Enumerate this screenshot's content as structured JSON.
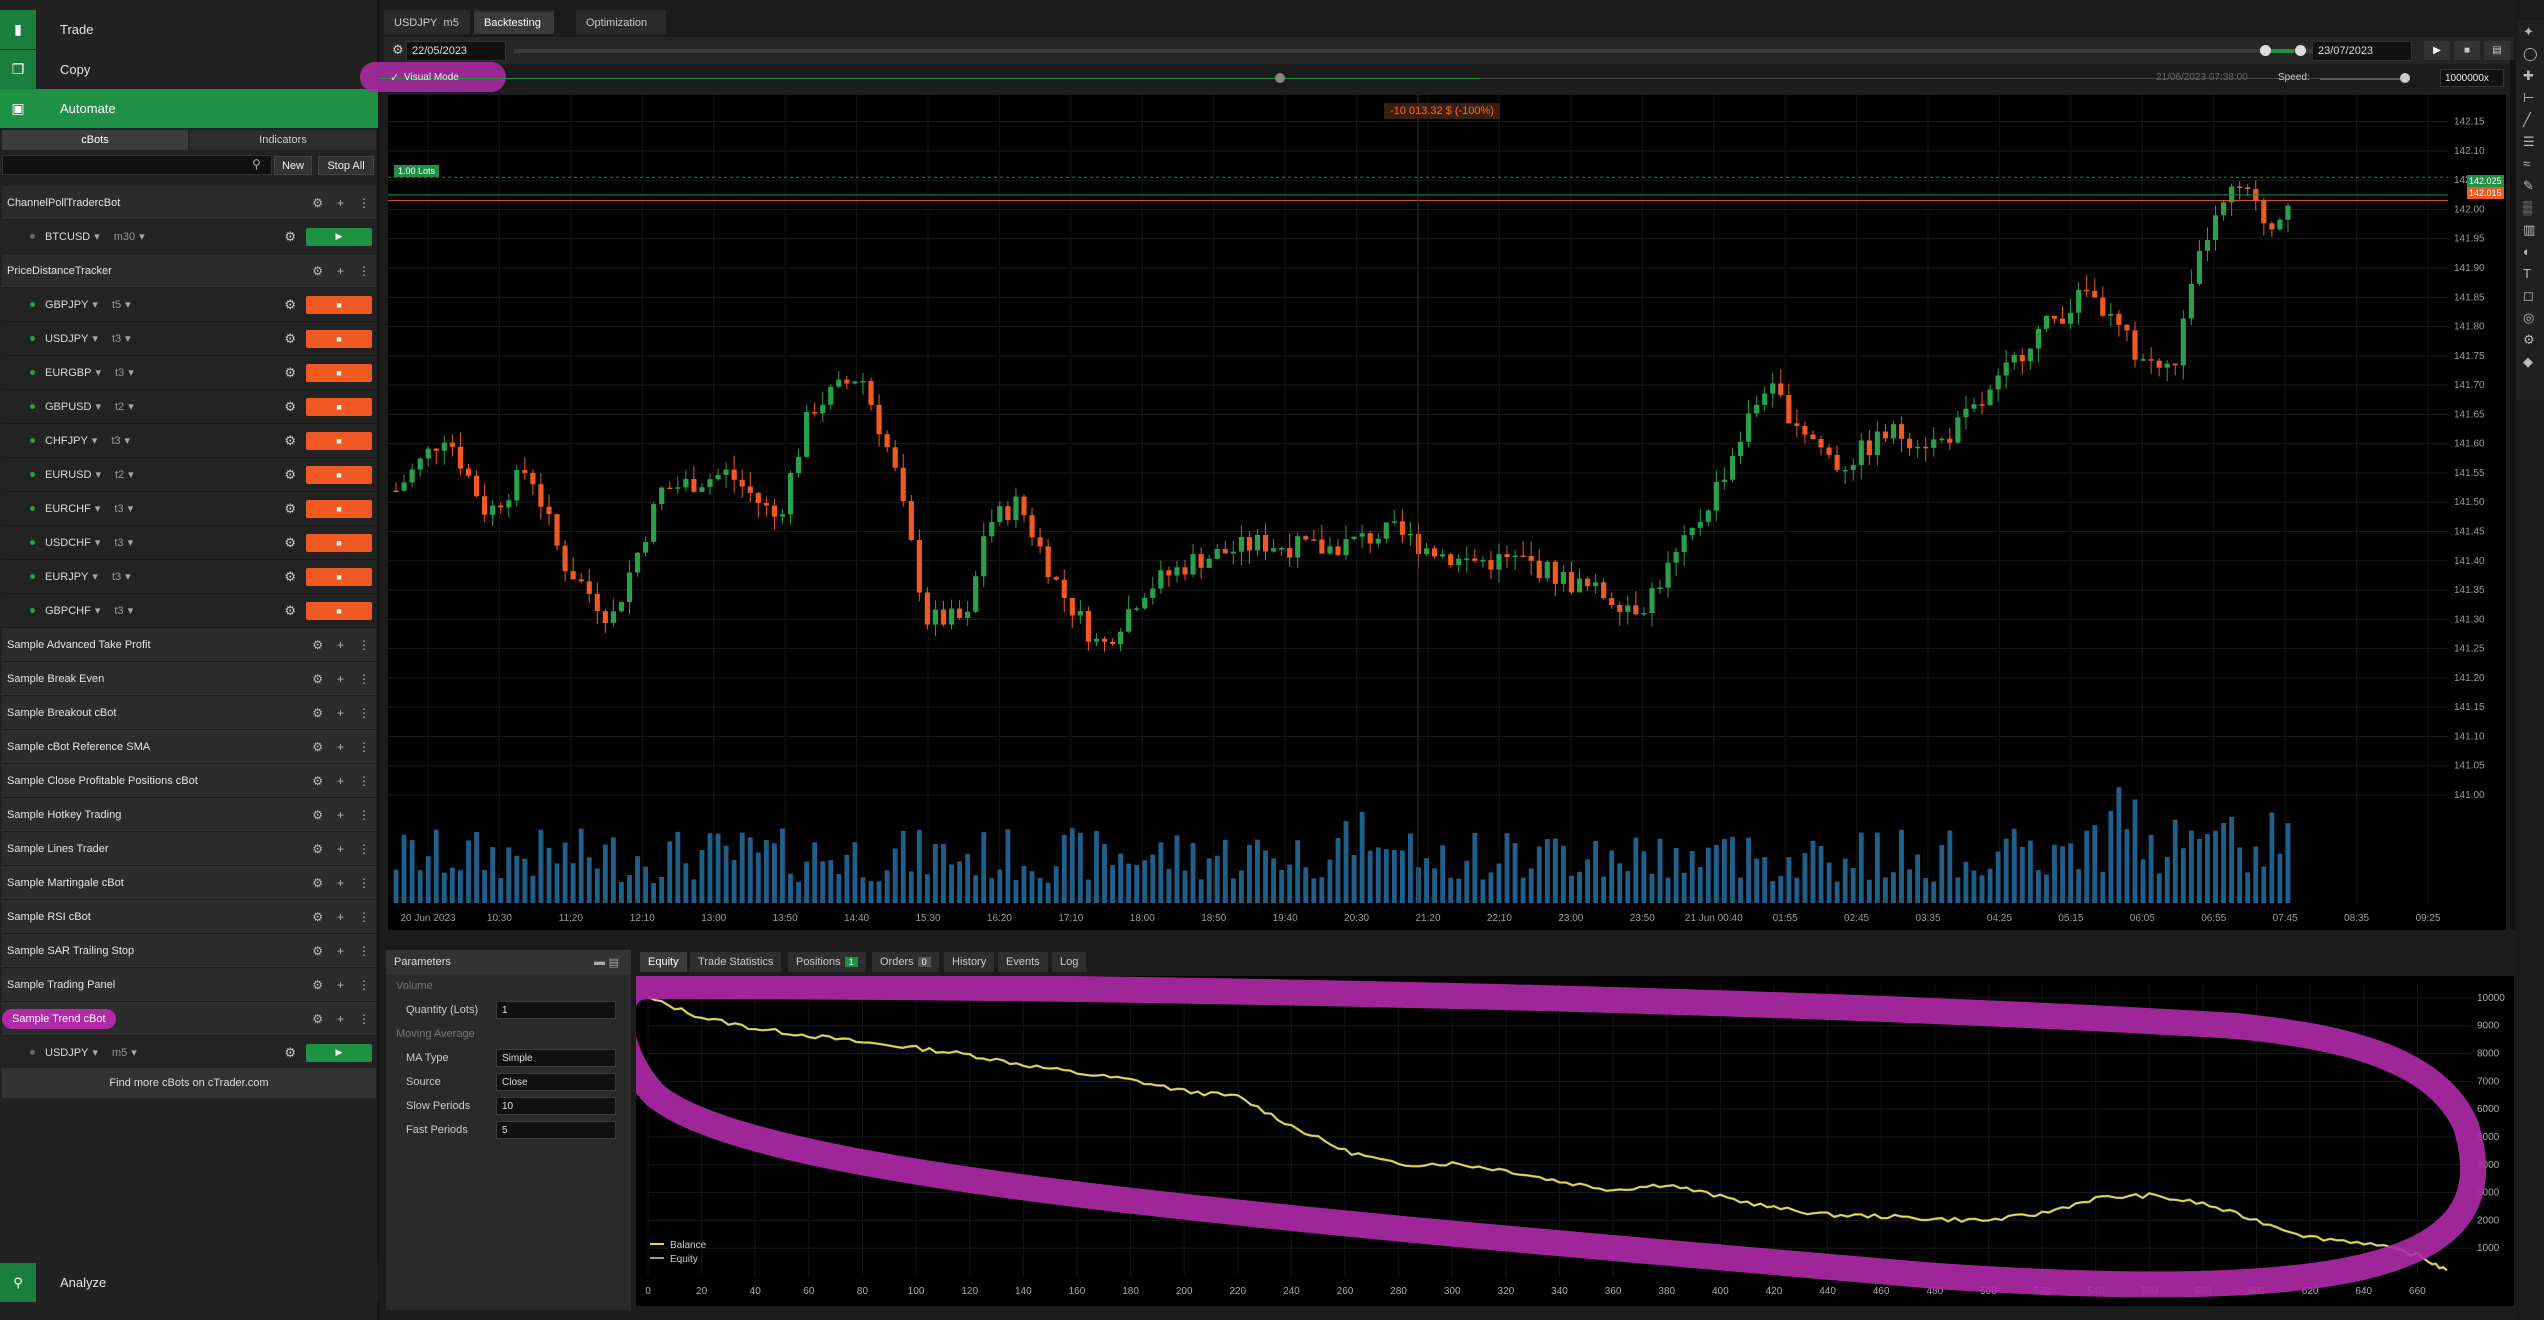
{
  "nav": {
    "trade": "Trade",
    "copy": "Copy",
    "automate": "Automate",
    "analyze": "Analyze"
  },
  "subtabs": [
    "cBots",
    "Indicators"
  ],
  "buttons": {
    "new": "New",
    "stop_all": "Stop All",
    "find_more": "Find more cBots on cTrader.com"
  },
  "bots": [
    {
      "type": "group",
      "name": "ChannelPollTradercBot"
    },
    {
      "type": "inst",
      "symbol": "BTCUSD",
      "tf": "m30",
      "running": false
    },
    {
      "type": "group",
      "name": "PriceDistanceTracker"
    },
    {
      "type": "inst",
      "symbol": "GBPJPY",
      "tf": "t5",
      "running": true
    },
    {
      "type": "inst",
      "symbol": "USDJPY",
      "tf": "t3",
      "running": true
    },
    {
      "type": "inst",
      "symbol": "EURGBP",
      "tf": "t3",
      "running": true
    },
    {
      "type": "inst",
      "symbol": "GBPUSD",
      "tf": "t2",
      "running": true
    },
    {
      "type": "inst",
      "symbol": "CHFJPY",
      "tf": "t3",
      "running": true
    },
    {
      "type": "inst",
      "symbol": "EURUSD",
      "tf": "t2",
      "running": true
    },
    {
      "type": "inst",
      "symbol": "EURCHF",
      "tf": "t3",
      "running": true
    },
    {
      "type": "inst",
      "symbol": "USDCHF",
      "tf": "t3",
      "running": true
    },
    {
      "type": "inst",
      "symbol": "EURJPY",
      "tf": "t3",
      "running": true
    },
    {
      "type": "inst",
      "symbol": "GBPCHF",
      "tf": "t3",
      "running": true
    },
    {
      "type": "group",
      "name": "Sample Advanced Take Profit"
    },
    {
      "type": "group",
      "name": "Sample Break Even"
    },
    {
      "type": "group",
      "name": "Sample Breakout cBot"
    },
    {
      "type": "group",
      "name": "Sample cBot Reference SMA"
    },
    {
      "type": "group",
      "name": "Sample Close Profitable Positions cBot"
    },
    {
      "type": "group",
      "name": "Sample Hotkey Trading"
    },
    {
      "type": "group",
      "name": "Sample Lines Trader"
    },
    {
      "type": "group",
      "name": "Sample Martingale cBot"
    },
    {
      "type": "group",
      "name": "Sample RSI cBot"
    },
    {
      "type": "group",
      "name": "Sample SAR Trailing Stop"
    },
    {
      "type": "group",
      "name": "Sample Trading Panel"
    },
    {
      "type": "group",
      "name": "Sample Trend cBot",
      "highlight": true
    },
    {
      "type": "inst",
      "symbol": "USDJPY",
      "tf": "m5",
      "running": false
    }
  ],
  "tabs": {
    "symbol": "USDJPY",
    "tf": "m5",
    "backtesting": "Backtesting",
    "optimization": "Optimization"
  },
  "ctrl": {
    "start_date": "22/05/2023",
    "end_date": "23/07/2023",
    "visual_mode": "Visual Mode",
    "current_time": "21/06/2023 07:38:00",
    "speed_label": "Speed:",
    "speed_value": "1000000x"
  },
  "chart": {
    "pnl_label": "-10 013.32 $ (-100%)",
    "lots_label": "1.00 Lots",
    "price_tag": "142.025",
    "price_tag2": "142.015",
    "y_ticks": [
      "142.15",
      "142.10",
      "142.05",
      "142.00",
      "141.95",
      "141.90",
      "141.85",
      "141.80",
      "141.75",
      "141.70",
      "141.65",
      "141.60",
      "141.55",
      "141.50",
      "141.45",
      "141.40",
      "141.35",
      "141.30",
      "141.25",
      "141.20",
      "141.15",
      "141.10",
      "141.05",
      "141.00"
    ],
    "x_ticks": [
      "20 Jun 2023",
      "10:30",
      "11:20",
      "12:10",
      "13:00",
      "13:50",
      "14:40",
      "15:30",
      "16:20",
      "17:10",
      "18:00",
      "18:50",
      "19:40",
      "20:30",
      "21:20",
      "22:10",
      "23:00",
      "23:50",
      "21 Jun 00:40",
      "01:55",
      "02:45",
      "03:35",
      "04:25",
      "05:15",
      "06:05",
      "06:55",
      "07:45",
      "08:35",
      "09:25"
    ]
  },
  "params": {
    "title": "Parameters",
    "sec_volume": "Volume",
    "quantity_label": "Quantity (Lots)",
    "quantity": "1",
    "sec_ma": "Moving Average",
    "ma_type_label": "MA Type",
    "ma_type": "Simple",
    "source_label": "Source",
    "source": "Close",
    "slow_label": "Slow Periods",
    "slow": "10",
    "fast_label": "Fast Periods",
    "fast": "5"
  },
  "btabs": {
    "equity": "Equity",
    "trade_stats": "Trade Statistics",
    "positions": "Positions",
    "positions_count": "1",
    "orders": "Orders",
    "orders_count": "0",
    "history": "History",
    "events": "Events",
    "log": "Log"
  },
  "chart_data": {
    "type": "line",
    "title": "",
    "x": [
      0,
      20,
      40,
      60,
      80,
      100,
      120,
      140,
      160,
      180,
      200,
      220,
      240,
      260,
      280,
      300,
      320,
      340,
      360,
      380,
      400,
      420,
      440,
      460,
      480,
      500,
      520,
      540,
      560,
      580,
      600,
      620,
      640,
      660,
      671
    ],
    "series": [
      {
        "name": "Balance",
        "values": [
          10000,
          9300,
          8900,
          8650,
          8400,
          8200,
          7950,
          7600,
          7300,
          7050,
          6650,
          6450,
          5400,
          4500,
          4000,
          4050,
          3800,
          3400,
          3100,
          3300,
          2850,
          2450,
          2200,
          2150,
          2050,
          2000,
          2250,
          2800,
          2900,
          2600,
          2000,
          1400,
          1200,
          750,
          200
        ]
      },
      {
        "name": "Equity",
        "values": [
          10000,
          9300,
          8900,
          8650,
          8400,
          8200,
          7950,
          7600,
          7300,
          7050,
          6650,
          6450,
          5400,
          4500,
          4000,
          4050,
          3800,
          3400,
          3100,
          3300,
          2850,
          2450,
          2200,
          2150,
          2050,
          2000,
          2250,
          2800,
          2900,
          2600,
          2000,
          1400,
          1200,
          750,
          200
        ]
      }
    ],
    "ylim": [
      0,
      10500
    ],
    "xlim": [
      0,
      680
    ],
    "y_ticks": [
      1000,
      2000,
      3000,
      4000,
      5000,
      6000,
      7000,
      8000,
      9000,
      10000
    ],
    "x_ticks": [
      0,
      20,
      40,
      60,
      80,
      100,
      120,
      140,
      160,
      180,
      200,
      220,
      240,
      260,
      280,
      300,
      320,
      340,
      360,
      380,
      400,
      420,
      440,
      460,
      480,
      500,
      520,
      540,
      560,
      580,
      600,
      620,
      640,
      660
    ],
    "legend": "bottom-left",
    "colors": {
      "balance": "#e8e030",
      "equity": "#9a9a9a"
    }
  }
}
